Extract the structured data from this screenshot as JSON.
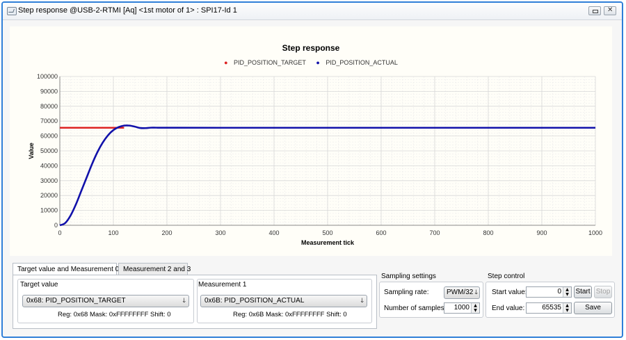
{
  "window": {
    "title": "Step response @USB-2-RTMI [Aq] <1st motor of 1> : SPI17-Id 1"
  },
  "chart_data": {
    "type": "line",
    "title": "Step response",
    "xlabel": "Measurement tick",
    "ylabel": "Value",
    "xlim": [
      0,
      1000
    ],
    "ylim": [
      0,
      100000
    ],
    "xticks": [
      0,
      100,
      200,
      300,
      400,
      500,
      600,
      700,
      800,
      900,
      1000
    ],
    "yticks": [
      0,
      10000,
      20000,
      30000,
      40000,
      50000,
      60000,
      70000,
      80000,
      90000,
      100000
    ],
    "grid": true,
    "legend_position": "top-center",
    "series": [
      {
        "name": "PID_POSITION_TARGET",
        "color": "#dd2222",
        "x": [
          0,
          120
        ],
        "y": [
          65535,
          65535
        ]
      },
      {
        "name": "PID_POSITION_ACTUAL",
        "color": "#1111aa",
        "x": [
          0,
          10,
          20,
          30,
          40,
          50,
          60,
          70,
          80,
          90,
          100,
          110,
          120,
          130,
          140,
          150,
          160,
          170,
          180,
          200,
          300,
          500,
          700,
          1000
        ],
        "y": [
          0,
          1500,
          6500,
          14000,
          23000,
          32000,
          41000,
          49000,
          55500,
          60500,
          64000,
          66000,
          67000,
          67000,
          66300,
          65400,
          65300,
          65600,
          65600,
          65550,
          65535,
          65535,
          65535,
          65535
        ]
      }
    ]
  },
  "tabs": [
    {
      "label": "Target value and Measurement 0"
    },
    {
      "label": "Measurement 2 and 3"
    }
  ],
  "target_value": {
    "title": "Target value",
    "selected": "0x68: PID_POSITION_TARGET",
    "info": "Reg: 0x68   Mask: 0xFFFFFFFF   Shift: 0"
  },
  "measurement1": {
    "title": "Measurement 1",
    "selected": "0x6B: PID_POSITION_ACTUAL",
    "info": "Reg: 0x6B   Mask: 0xFFFFFFFF   Shift: 0"
  },
  "sampling": {
    "title": "Sampling settings",
    "rate_label": "Sampling rate:",
    "rate_value": "PWM/32",
    "samples_label": "Number of samples:",
    "samples_value": "1000"
  },
  "step_control": {
    "title": "Step control",
    "start_label": "Start value:",
    "start_value": "0",
    "end_label": "End value:",
    "end_value": "65535",
    "start_button": "Start",
    "stop_button": "Stop",
    "save_button": "Save"
  }
}
